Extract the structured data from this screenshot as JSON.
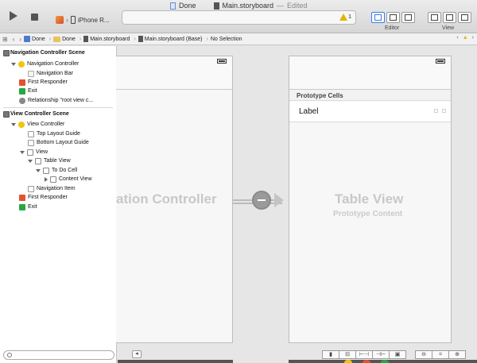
{
  "window": {
    "document_name": "Done",
    "file_name": "Main.storyboard",
    "edited_status": "Edited",
    "separator": "—"
  },
  "toolbar": {
    "scheme_device": "iPhone R...",
    "warning_count": "1",
    "editor_label": "Editor",
    "view_label": "View"
  },
  "jumpbar": {
    "crumbs": [
      "Done",
      "Done",
      "Main.storyboard",
      "Main.storyboard (Base)",
      "No Selection"
    ]
  },
  "outline": {
    "nav_scene": {
      "title": "Navigation Controller Scene",
      "controller": "Navigation Controller",
      "nav_bar": "Navigation Bar",
      "first_responder": "First Responder",
      "exit": "Exit",
      "relationship": "Relationship \"root view c..."
    },
    "vc_scene": {
      "title": "View Controller Scene",
      "controller": "View Controller",
      "top_guide": "Top Layout Guide",
      "bottom_guide": "Bottom Layout Guide",
      "view": "View",
      "table_view": "Table View",
      "cell": "To Do Cell",
      "content_view": "Content View",
      "nav_item": "Navigation Item",
      "first_responder": "First Responder",
      "exit": "Exit"
    }
  },
  "canvas": {
    "nav_controller_title": "ation Controller",
    "table_view_title": "Table View",
    "table_view_subtitle": "Prototype Content",
    "prototype_cells_header": "Prototype Cells",
    "cell_label": "Label"
  },
  "colors": {
    "accent": "#3b7be8",
    "warning": "#e4b400",
    "first_responder": "#e2532d",
    "exit": "#27a844"
  }
}
